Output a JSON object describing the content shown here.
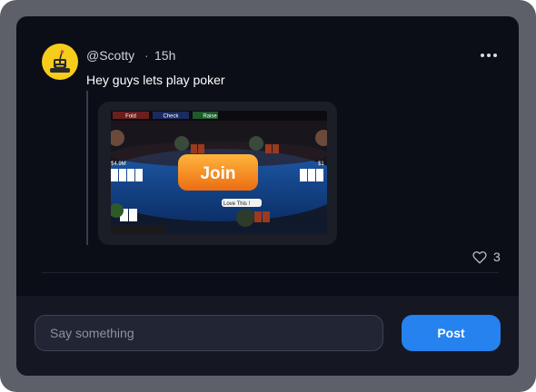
{
  "post": {
    "username": "@Scotty",
    "separator": "·",
    "time": "15h",
    "message": "Hey guys lets play poker",
    "likes": "3",
    "avatar_icon": "robot-icon",
    "more_icon": "more-horizontal-icon",
    "like_icon": "heart-icon"
  },
  "game": {
    "actions": [
      "Fold",
      "Check",
      "Raise"
    ],
    "join_label": "Join",
    "chip_left": "$4.9M",
    "chip_right": "$1",
    "love_label": "Love This !"
  },
  "composer": {
    "placeholder": "Say something",
    "post_label": "Post"
  },
  "colors": {
    "accent": "#2582ee",
    "avatar_bg": "#f6cd1a",
    "join_orange": "#f38b1e"
  }
}
